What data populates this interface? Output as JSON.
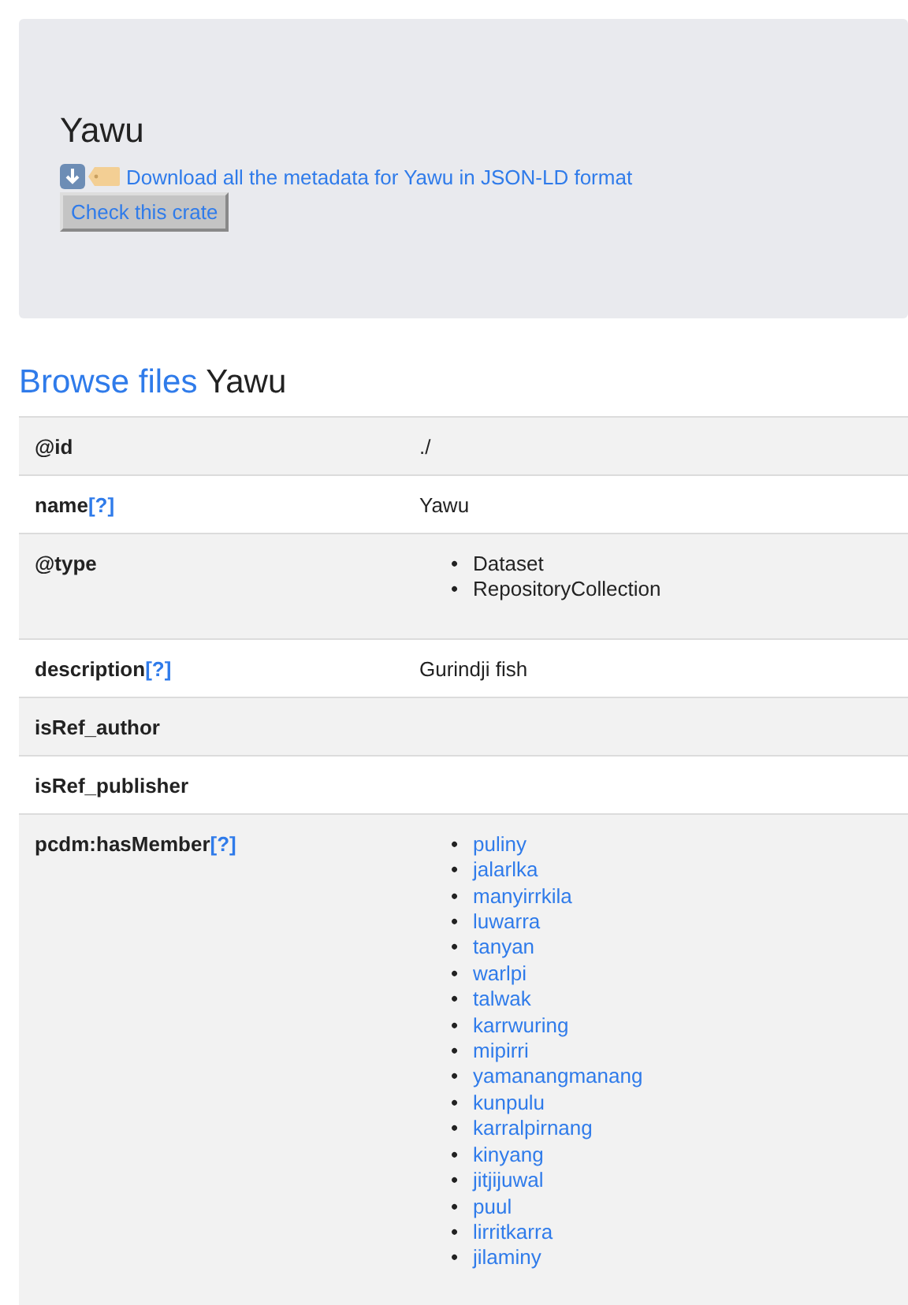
{
  "header": {
    "title": "Yawu",
    "download_link": "Download all the metadata for Yawu in JSON-LD format",
    "check_button": "Check this crate"
  },
  "browse": {
    "link": "Browse files",
    "name": "Yawu"
  },
  "rows": [
    {
      "key": "@id",
      "help": null,
      "kind": "text",
      "value": "./"
    },
    {
      "key": "name",
      "help": "[?]",
      "kind": "text",
      "value": "Yawu"
    },
    {
      "key": "@type",
      "help": null,
      "kind": "list",
      "bullet": "•",
      "items": [
        "Dataset",
        "RepositoryCollection"
      ]
    },
    {
      "key": "description",
      "help": "[?]",
      "kind": "text",
      "value": "Gurindji fish"
    },
    {
      "key": "isRef_author",
      "help": null,
      "kind": "empty"
    },
    {
      "key": "isRef_publisher",
      "help": null,
      "kind": "empty"
    },
    {
      "key": "pcdm:hasMember",
      "help": "[?]",
      "kind": "links",
      "bullet": "•",
      "items": [
        "puliny",
        "jalarlka",
        "manyirrkila",
        "luwarra",
        "tanyan",
        "warlpi",
        "talwak",
        "karrwuring",
        "mipirri",
        "yamanangmanang",
        "kunpulu",
        "karralpirnang",
        "kinyang",
        "jitjijuwal",
        "puul",
        "lirritkarra",
        "jilaminy"
      ]
    }
  ]
}
